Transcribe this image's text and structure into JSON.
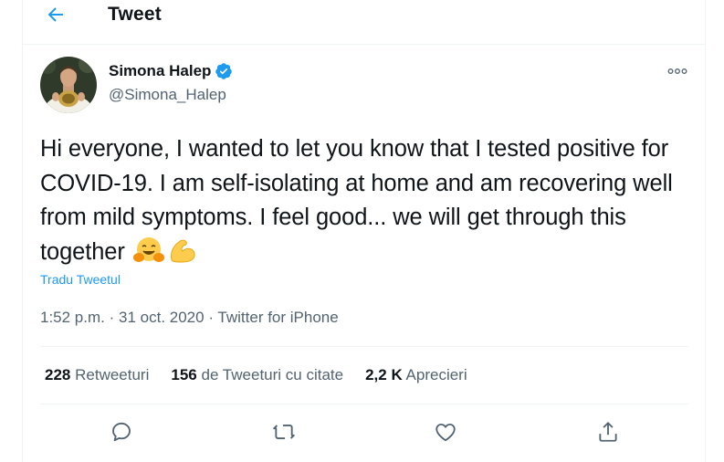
{
  "header": {
    "title": "Tweet",
    "back_icon": "arrow-left-icon"
  },
  "author": {
    "name": "Simona Halep",
    "handle": "@Simona_Halep",
    "verified_icon": "verified-badge-icon",
    "avatar": "avatar-photo"
  },
  "more_icon": "more-options-icon",
  "tweet": {
    "text": "Hi everyone, I wanted to let you know that I tested positive for COVID-19. I am self-isolating at home and am recovering well from mild symptoms. I feel good... we will get through this together",
    "emojis": [
      "hugging-face-emoji",
      "flexed-biceps-emoji"
    ],
    "translate_label": "Tradu Tweetul"
  },
  "meta": {
    "time": "1:52 p.m.",
    "separator": "·",
    "date": "31 oct. 2020",
    "source": "Twitter for iPhone"
  },
  "stats": {
    "retweets_count": "228",
    "retweets_label": "Retweeturi",
    "quotes_count": "156",
    "quotes_label": "de Tweeturi cu citate",
    "likes_count": "2,2 K",
    "likes_label": "Aprecieri"
  },
  "actions": [
    "reply-icon",
    "retweet-icon",
    "like-icon",
    "share-icon"
  ],
  "colors": {
    "accent": "#1d9bf0",
    "text": "#0f1419",
    "secondary": "#536471",
    "border": "#eff3f4"
  }
}
